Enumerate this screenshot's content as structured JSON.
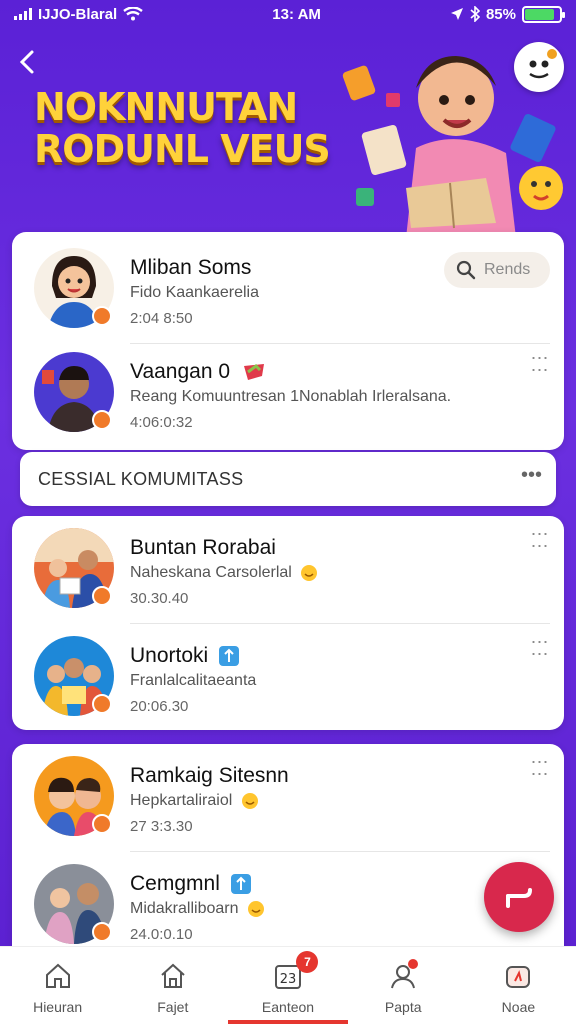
{
  "status_bar": {
    "carrier": "IJJO-Blaral",
    "time": "13: AM",
    "battery_percent": "85%",
    "battery_level": 0.85
  },
  "header": {
    "back_icon": "chevron-left-icon",
    "title_line1": "NOKNNUTAN",
    "title_line2": "RODUNL VEUS",
    "title_color": "#ffd23a"
  },
  "top_card": {
    "search": {
      "label": "Rends",
      "icon": "search-icon"
    },
    "rows": [
      {
        "name": "Mliban Soms",
        "subtitle": "Fido Kaankaerelia",
        "time": "2:04 8:50"
      },
      {
        "name": "Vaangan 0",
        "subtitle": "Reang Komuuntresan 1Nonablah Irleralsana.",
        "time": "4:06:0:32"
      }
    ]
  },
  "section": {
    "title": "CESSIAL KOMUMITASS"
  },
  "mid_card": {
    "rows": [
      {
        "name": "Buntan Rorabai",
        "subtitle": "Naheskana Carsolerlal",
        "time": "30.30.40"
      },
      {
        "name": "Unortoki",
        "subtitle": "Franlalcalitaeanta",
        "time": "20:06.30"
      }
    ]
  },
  "bottom_card": {
    "rows": [
      {
        "name": "Ramkaig Sitesnn",
        "subtitle": "Hepkartaliraiol",
        "time": "27 3:3.30"
      },
      {
        "name": "Cemgmnl",
        "subtitle": "Midakralliboarn",
        "time": "24.0:0.10"
      }
    ]
  },
  "bottom_nav": {
    "items": [
      {
        "label": "Hieuran",
        "icon": "home-icon"
      },
      {
        "label": "Fajet",
        "icon": "home-outline-icon"
      },
      {
        "label": "Eanteon",
        "icon": "calendar-icon",
        "badge": "7"
      },
      {
        "label": "Papta",
        "icon": "person-icon"
      },
      {
        "label": "Noae",
        "icon": "bag-icon"
      }
    ]
  },
  "colors": {
    "accent": "#e5362f",
    "fab": "#d8284c",
    "background": "#5b21d6"
  }
}
